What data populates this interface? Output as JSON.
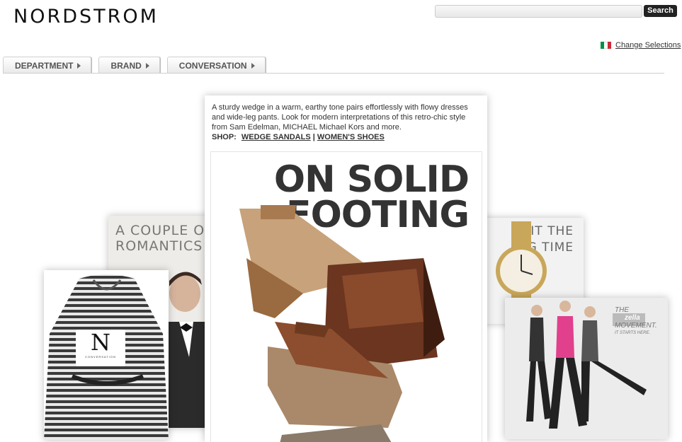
{
  "header": {
    "logo": "NORDSTROM",
    "search_button": "Search",
    "change_selections": "Change Selections"
  },
  "tabs": [
    {
      "label": "DEPARTMENT"
    },
    {
      "label": "BRAND"
    },
    {
      "label": "CONVERSATION"
    }
  ],
  "feature": {
    "description": "A sturdy wedge in a warm, earthy tone pairs effortlessly with flowy dresses and wide-leg pants. Look for modern interpretations of this retro-chic style from Sam Edelman, MICHAEL Michael Kors and more.",
    "shop_label": "SHOP:",
    "link1": "WEDGE SANDALS",
    "separator": "|",
    "link2": "WOMEN'S SHOES",
    "headline_line1": "ON SOLID",
    "headline_line2": "FOOTING"
  },
  "cards": {
    "romantics_line1": "A COUPLE OF",
    "romantics_line2": "ROMANTICS",
    "hit_line1": "HIT THE",
    "hit_line2": "G TIME",
    "badge_letter": "N",
    "badge_small": "CONVERSATION",
    "zella_line1": "THE",
    "zella_brand": "zella",
    "zella_line2": "MOVEMENT.",
    "zella_line3": "IT STARTS HERE."
  },
  "colors": {
    "flag_green": "#009246",
    "flag_white": "#ffffff",
    "flag_red": "#ce2b37",
    "search_button_bg": "#222222"
  }
}
